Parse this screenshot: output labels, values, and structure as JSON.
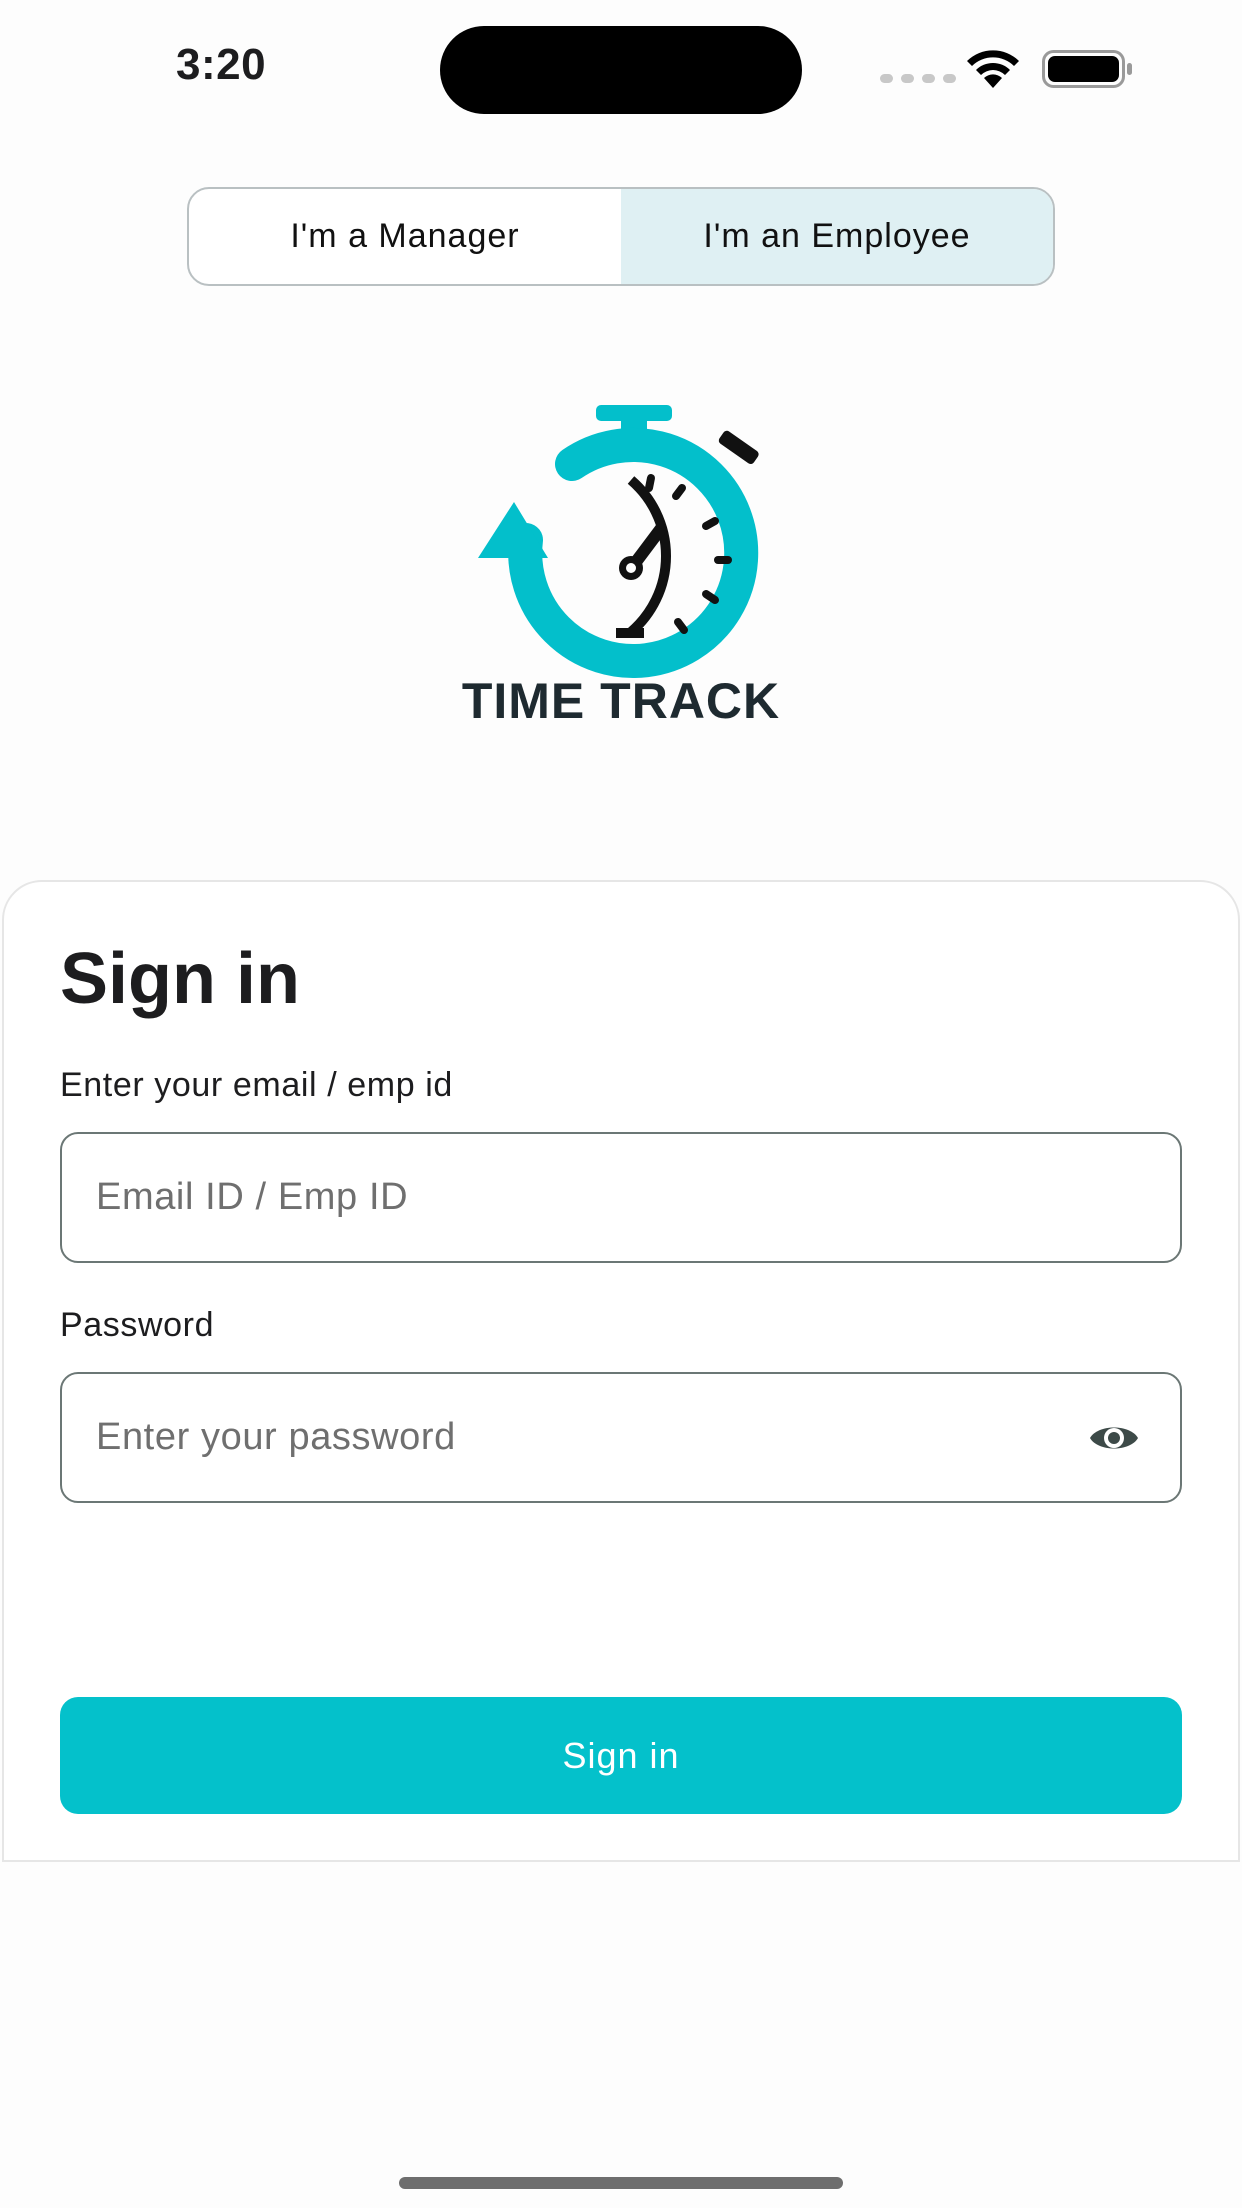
{
  "status_bar": {
    "time": "3:20"
  },
  "role_toggle": {
    "options": [
      {
        "label": "I'm a Manager",
        "selected": false
      },
      {
        "label": "I'm an Employee",
        "selected": true
      }
    ]
  },
  "logo": {
    "text": "TIME TRACK",
    "accent_color": "#03bfcb"
  },
  "form": {
    "title": "Sign in",
    "email_label": "Enter your email / emp id",
    "email_placeholder": "Email ID / Emp ID",
    "email_value": "",
    "password_label": "Password",
    "password_placeholder": "Enter your password",
    "password_value": "",
    "submit_label": "Sign in"
  },
  "colors": {
    "primary": "#04c1cb",
    "segment_active_bg": "#dff0f3"
  },
  "icons": {
    "password_toggle": "eye-icon"
  }
}
